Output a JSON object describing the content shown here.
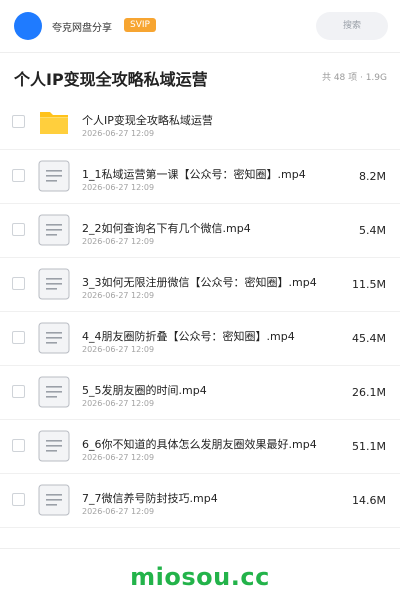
{
  "header": {
    "user_name": "夸克网盘分享",
    "badge": "SVIP",
    "search_placeholder": "搜索"
  },
  "folder": {
    "title": "个人IP变现全攻略私域运营",
    "count_text": "共 48 项 · 1.9G"
  },
  "files": [
    {
      "name": "个人IP变现全攻略私域运营",
      "date": "2026-06-27 12:09",
      "size": "",
      "icon": "folder-icon"
    },
    {
      "name": "1_1私域运营第一课【公众号：密知圈】.mp4",
      "date": "2026-06-27 12:09",
      "size": "8.2M",
      "icon": "document-icon"
    },
    {
      "name": "2_2如何查询名下有几个微信.mp4",
      "date": "2026-06-27 12:09",
      "size": "5.4M",
      "icon": "document-icon"
    },
    {
      "name": "3_3如何无限注册微信【公众号：密知圈】.mp4",
      "date": "2026-06-27 12:09",
      "size": "11.5M",
      "icon": "document-icon"
    },
    {
      "name": "4_4朋友圈防折叠【公众号：密知圈】.mp4",
      "date": "2026-06-27 12:09",
      "size": "45.4M",
      "icon": "document-icon"
    },
    {
      "name": "5_5发朋友圈的时间.mp4",
      "date": "2026-06-27 12:09",
      "size": "26.1M",
      "icon": "document-icon"
    },
    {
      "name": "6_6你不知道的具体怎么发朋友圈效果最好.mp4",
      "date": "2026-06-27 12:09",
      "size": "51.1M",
      "icon": "document-icon"
    },
    {
      "name": "7_7微信养号防封技巧.mp4",
      "date": "2026-06-27 12:09",
      "size": "14.6M",
      "icon": "document-icon"
    }
  ],
  "watermark": "miosou.cc",
  "colors": {
    "avatar": "#1f7bff",
    "badge": "#f7a531",
    "folder": "#ffc21a",
    "watermark": "#23b34a"
  }
}
